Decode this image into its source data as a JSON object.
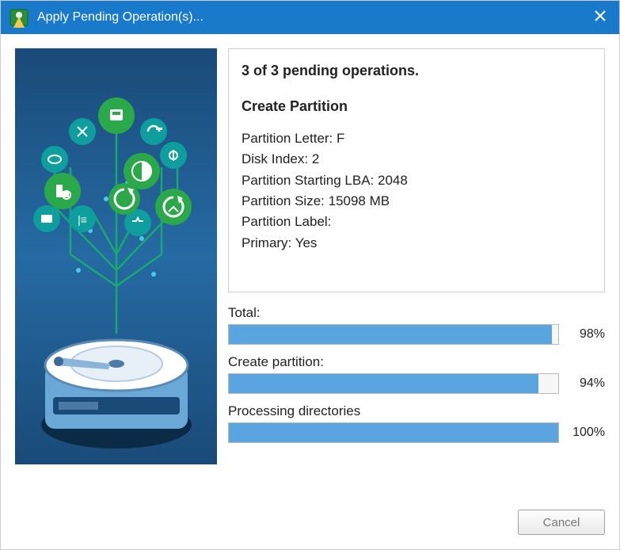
{
  "titlebar": {
    "title": "Apply Pending Operation(s)..."
  },
  "info": {
    "status_line": "3 of 3 pending operations.",
    "operation_name": "Create Partition",
    "details": {
      "partition_letter_label": "Partition Letter: ",
      "partition_letter_value": "F",
      "disk_index_label": "Disk Index: ",
      "disk_index_value": "2",
      "starting_lba_label": "Partition Starting LBA: ",
      "starting_lba_value": "2048",
      "size_label": "Partition Size: ",
      "size_value": "15098 MB",
      "label_label": "Partition Label:",
      "label_value": "",
      "primary_label": "Primary: ",
      "primary_value": "Yes"
    }
  },
  "progress": {
    "total": {
      "label": "Total:",
      "percent": 98,
      "text": "98%"
    },
    "create": {
      "label": "Create partition:",
      "percent": 94,
      "text": "94%"
    },
    "processing": {
      "label": "Processing directories",
      "percent": 100,
      "text": "100%"
    }
  },
  "buttons": {
    "cancel": "Cancel"
  }
}
